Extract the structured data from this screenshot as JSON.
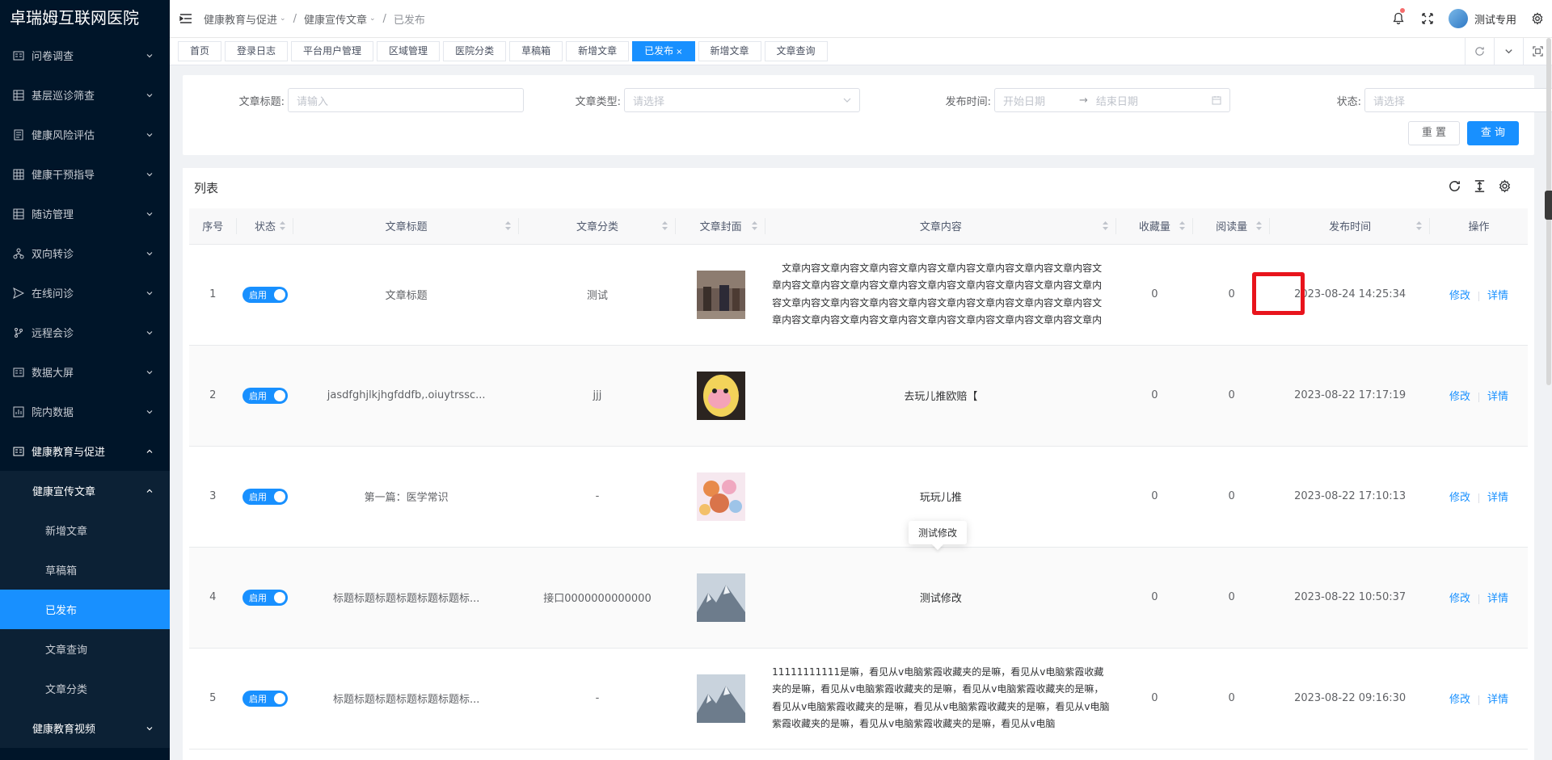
{
  "app": {
    "logo": "卓瑞姆互联网医院"
  },
  "sidebar": {
    "items": [
      {
        "label": "问卷调查",
        "icon": "form-icon"
      },
      {
        "label": "基层巡诊筛查",
        "icon": "grid-icon"
      },
      {
        "label": "健康风险评估",
        "icon": "doc-icon"
      },
      {
        "label": "健康干预指导",
        "icon": "table-icon"
      },
      {
        "label": "随访管理",
        "icon": "grid-icon"
      },
      {
        "label": "双向转诊",
        "icon": "branch-icon"
      },
      {
        "label": "在线问诊",
        "icon": "send-icon"
      },
      {
        "label": "远程会诊",
        "icon": "fork-icon"
      },
      {
        "label": "数据大屏",
        "icon": "form-icon"
      },
      {
        "label": "院内数据",
        "icon": "chart-icon"
      },
      {
        "label": "健康教育与促进",
        "icon": "form-icon"
      }
    ],
    "submenu_label": "健康宣传文章",
    "subsub": [
      "新增文章",
      "草稿箱",
      "已发布",
      "文章查询",
      "文章分类"
    ],
    "last_item": "健康教育视频"
  },
  "header": {
    "breadcrumb": [
      "健康教育与促进",
      "健康宣传文章",
      "已发布"
    ],
    "user": "测试专用"
  },
  "tabs": [
    "首页",
    "登录日志",
    "平台用户管理",
    "区域管理",
    "医院分类",
    "草稿箱",
    "新增文章",
    "已发布",
    "新增文章",
    "文章查询"
  ],
  "active_tab_index": 7,
  "search": {
    "title_label": "文章标题:",
    "title_placeholder": "请输入",
    "type_label": "文章类型:",
    "type_placeholder": "请选择",
    "time_label": "发布时间:",
    "start_placeholder": "开始日期",
    "end_placeholder": "结束日期",
    "status_label": "状态:",
    "status_placeholder": "请选择",
    "reset": "重 置",
    "query": "查 询"
  },
  "list": {
    "title": "列表",
    "columns": [
      "序号",
      "状态",
      "文章标题",
      "文章分类",
      "文章封面",
      "文章内容",
      "收藏量",
      "阅读量",
      "发布时间",
      "操作"
    ],
    "rows": [
      {
        "no": "1",
        "status": "启用",
        "title": "文章标题",
        "category": "测试",
        "content": "文章内容文章内容文章内容文章内容文章内容文章内容文章内容文章内容文章内容文章内容文章内容文章内容文章内容文章内容文章内容文章内容文章内容文章内容文章内容文章内容文章内容文章内容文章内容文章内容文章内容文章内容文章内容文章内容文章内容文章内容文章内容文章内容文章内容文章内容",
        "fav": "0",
        "read": "0",
        "time": "2023-08-24 14:25:34"
      },
      {
        "no": "2",
        "status": "启用",
        "title": "jasdfghjlkjhgfddfb,.oiuytrssc...",
        "category": "jjj",
        "content": "去玩儿推欧赔【",
        "fav": "0",
        "read": "0",
        "time": "2023-08-22 17:17:19"
      },
      {
        "no": "3",
        "status": "启用",
        "title": "第一篇：医学常识",
        "category": "-",
        "content": "玩玩儿推",
        "fav": "0",
        "read": "0",
        "time": "2023-08-22 17:10:13"
      },
      {
        "no": "4",
        "status": "启用",
        "title": "标题标题标题标题标题标题标...",
        "category": "接口0000000000000",
        "content": "测试修改",
        "fav": "0",
        "read": "0",
        "time": "2023-08-22 10:50:37"
      },
      {
        "no": "5",
        "status": "启用",
        "title": "标题标题标题标题标题标题标...",
        "category": "-",
        "content": "11111111111是嘛，看见从v电脑紫霞收藏夹的是嘛，看见从v电脑紫霞收藏夹的是嘛，看见从v电脑紫霞收藏夹的是嘛，看见从v电脑紫霞收藏夹的是嘛，看见从v电脑紫霞收藏夹的是嘛，看见从v电脑紫霞收藏夹的是嘛，看见从v电脑紫霞收藏夹的是嘛，看见从v电脑紫霞收藏夹的是嘛，看见从v电脑",
        "fav": "0",
        "read": "0",
        "time": "2023-08-22 09:16:30"
      }
    ],
    "edit": "修改",
    "detail": "详情",
    "tooltip": "测试修改"
  },
  "colors": {
    "primary": "#1890ff",
    "sidebar_bg": "#001529",
    "highlight": "#e8141c"
  }
}
